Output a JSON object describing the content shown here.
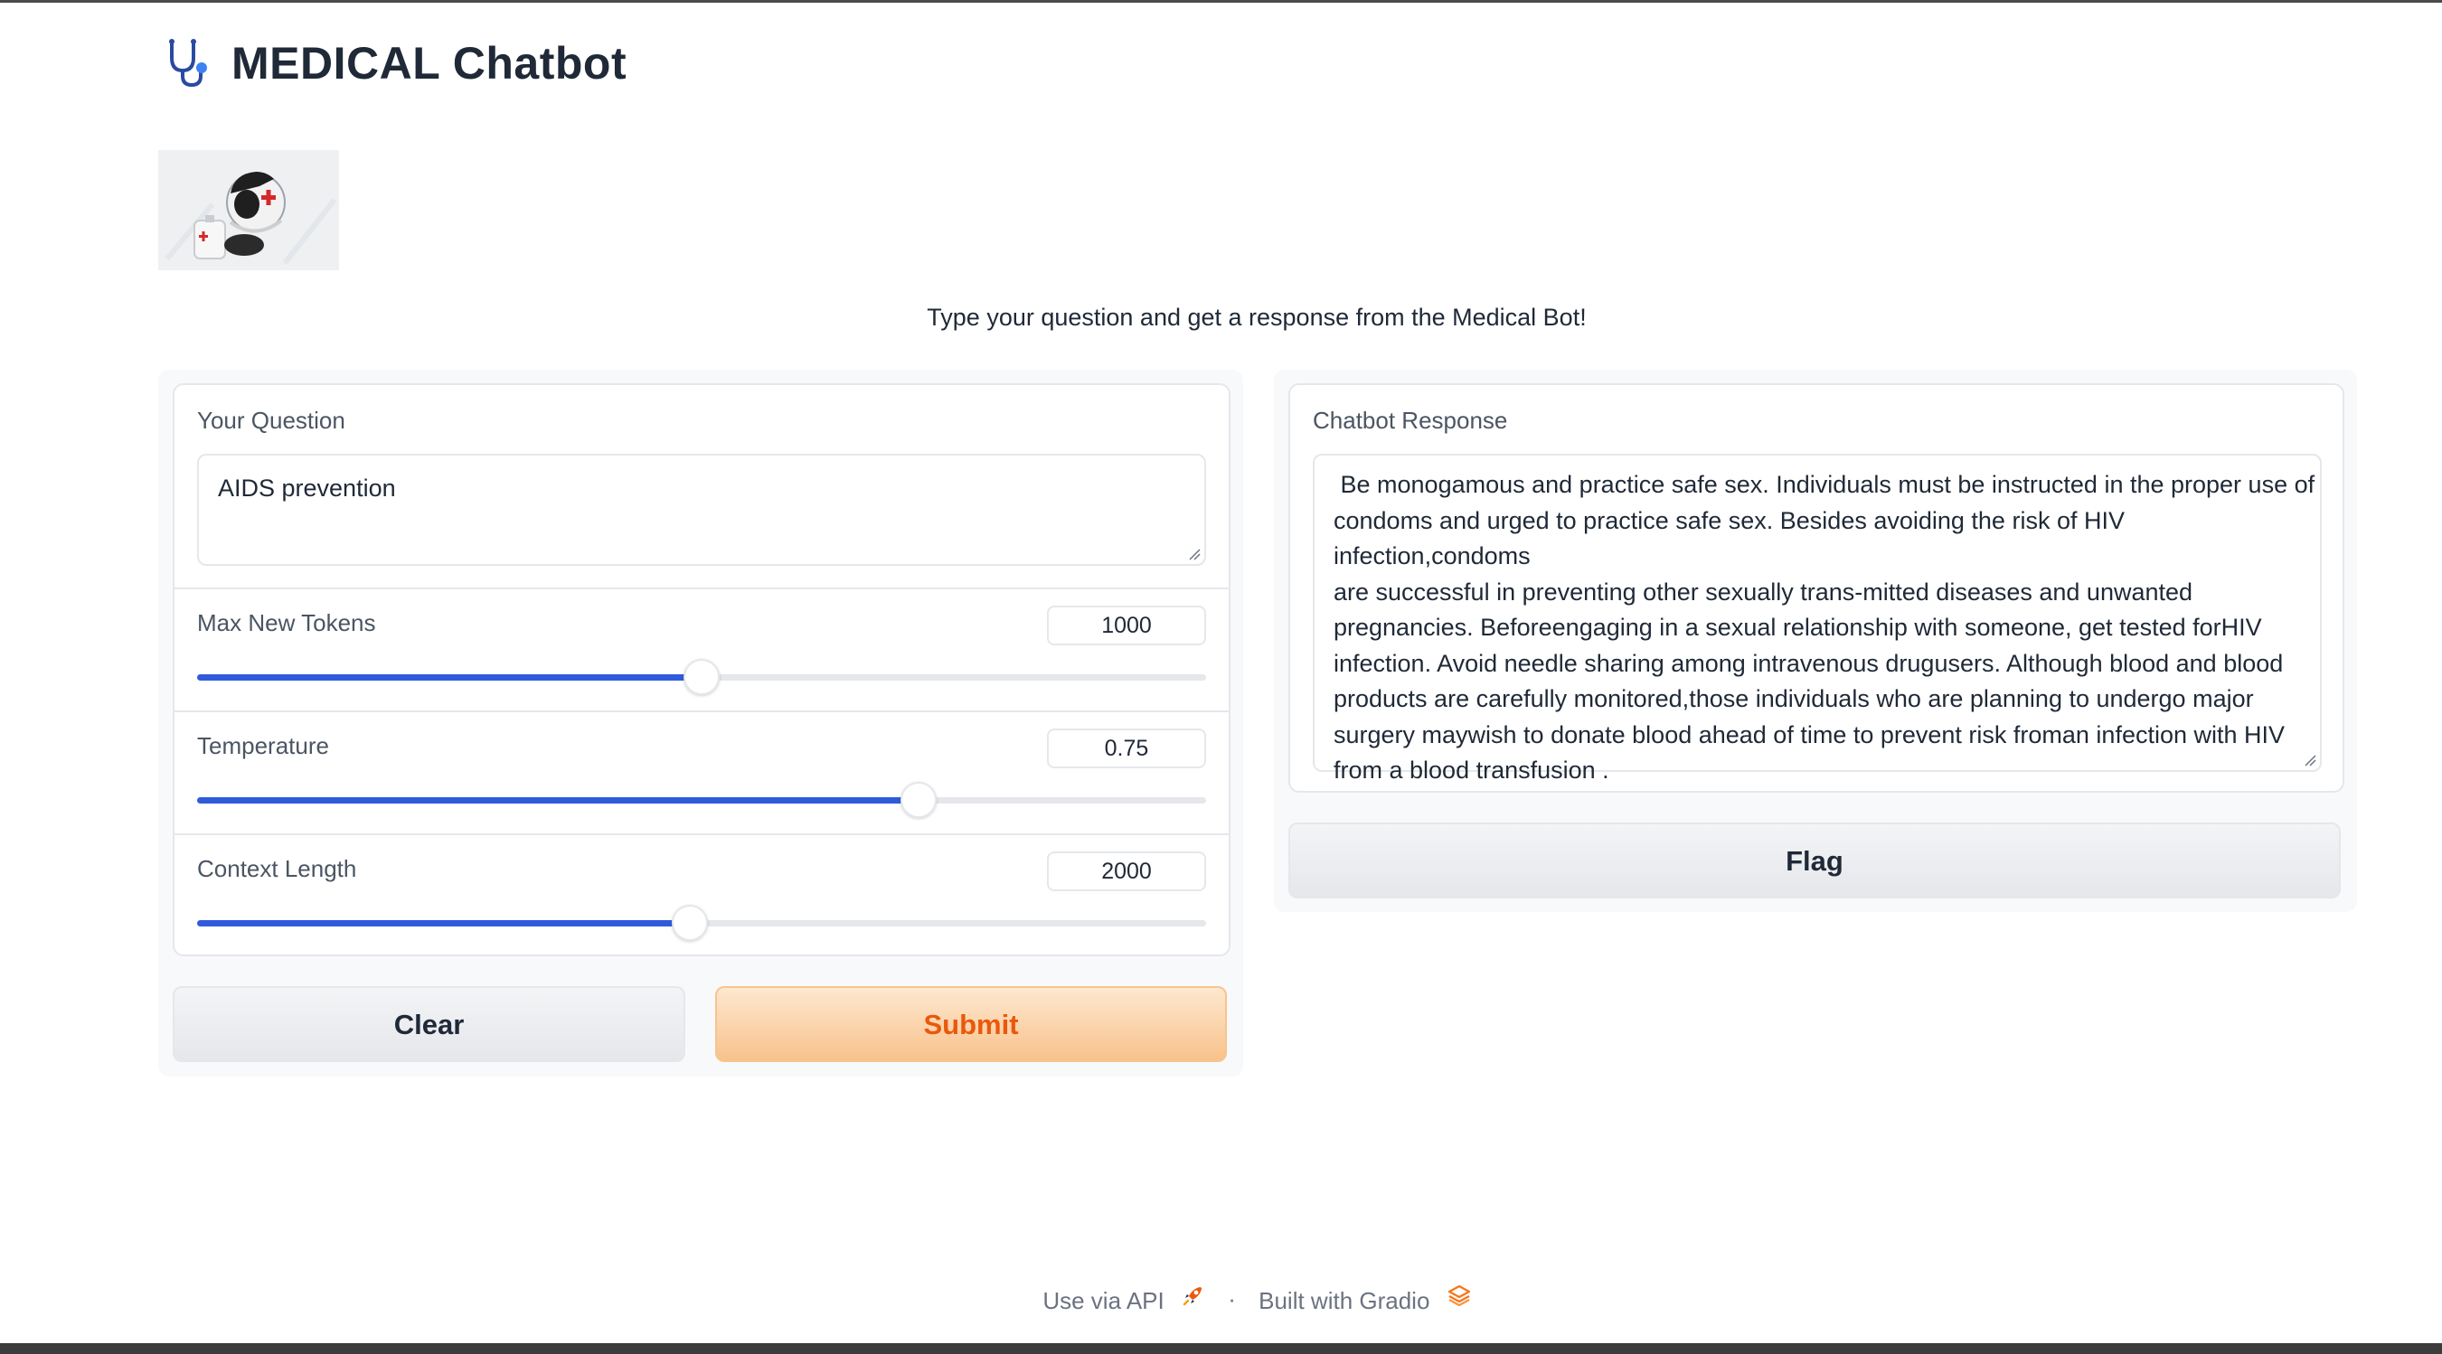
{
  "app": {
    "title": "MEDICAL Chatbot",
    "description": "Type your question and get a response from the Medical Bot!"
  },
  "inputs": {
    "question_label": "Your Question",
    "question_value": "AIDS prevention",
    "sliders": [
      {
        "label": "Max New Tokens",
        "value": "1000",
        "fraction": 0.5
      },
      {
        "label": "Temperature",
        "value": "0.75",
        "fraction": 0.715
      },
      {
        "label": "Context Length",
        "value": "2000",
        "fraction": 0.488
      }
    ]
  },
  "buttons": {
    "clear": "Clear",
    "submit": "Submit",
    "flag": "Flag"
  },
  "output": {
    "label": "Chatbot Response",
    "lines": [
      " Be monogamous and practice safe sex. Individuals must be instructed in the proper use of",
      "condoms and urged to practice safe sex. Besides avoiding the risk of HIV infection,condoms",
      "are successful in preventing other sexually trans-mitted diseases and unwanted",
      "pregnancies. Beforeengaging in a sexual relationship with someone, get tested forHIV",
      "infection. Avoid needle sharing among intravenous drugusers. Although blood and blood",
      "products are carefully monitored,those individuals who are planning to undergo major",
      "surgery maywish to donate blood ahead of time to prevent risk froman infection with HIV",
      "from a blood transfusion ."
    ]
  },
  "footer": {
    "api": "Use via API",
    "separator": "·",
    "built": "Built with Gradio"
  },
  "colors": {
    "accent_blue": "#2f5bdb",
    "submit_text": "#ea580c",
    "submit_bg": "#f8c28c"
  },
  "icons": {
    "header": "stethoscope-icon",
    "api": "rocket-icon",
    "gradio": "gradio-logo-icon"
  }
}
